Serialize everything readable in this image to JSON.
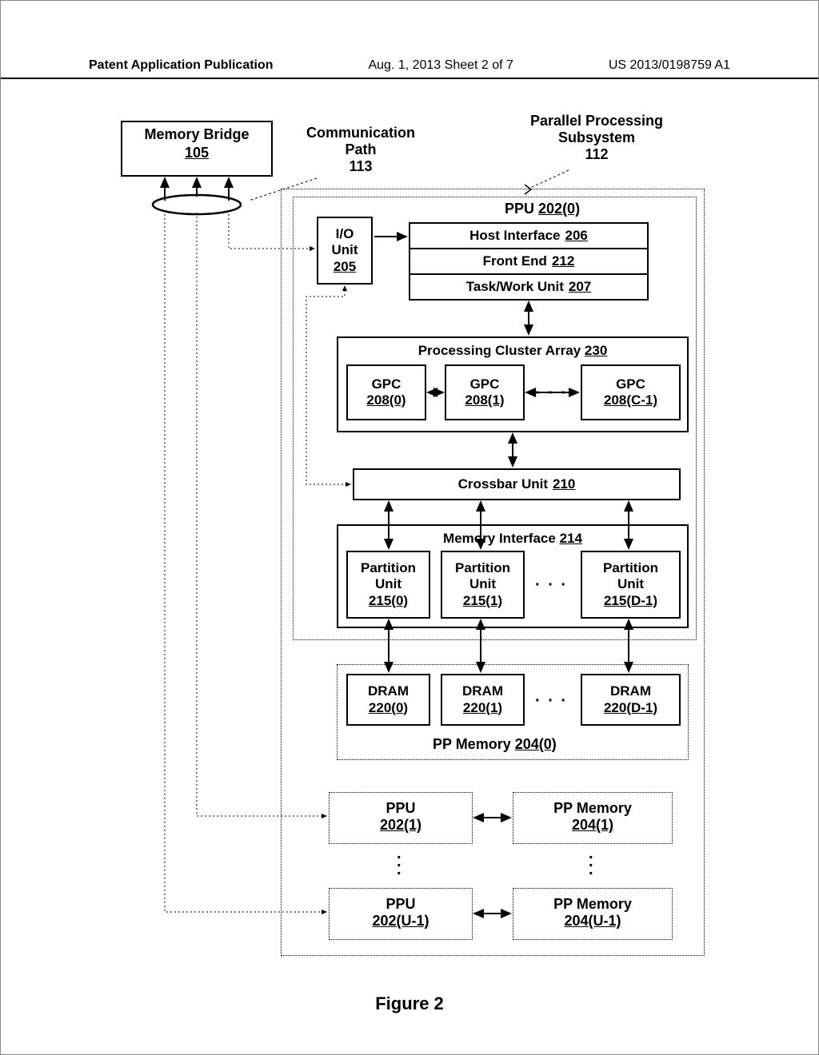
{
  "header": {
    "left": "Patent Application Publication",
    "mid": "Aug. 1, 2013  Sheet 2 of 7",
    "right": "US 2013/0198759 A1"
  },
  "labels": {
    "memory_bridge": "Memory Bridge",
    "memory_bridge_ref": "105",
    "comm_path": "Communication",
    "comm_path2": "Path",
    "comm_path_ref": "113",
    "pps": "Parallel Processing",
    "pps2": "Subsystem",
    "pps_ref": "112",
    "ppu0": "PPU",
    "ppu0_ref": "202(0)",
    "io_unit": "I/O",
    "io_unit2": "Unit",
    "io_unit_ref": "205",
    "host_if": "Host Interface",
    "host_if_ref": "206",
    "front_end": "Front End",
    "front_end_ref": "212",
    "task_work": "Task/Work Unit",
    "task_work_ref": "207",
    "pca": "Processing Cluster Array",
    "pca_ref": "230",
    "gpc": "GPC",
    "gpc0_ref": "208(0)",
    "gpc1_ref": "208(1)",
    "gpcC_ref": "208(C-1)",
    "crossbar": "Crossbar Unit",
    "crossbar_ref": "210",
    "mem_if": "Memory Interface",
    "mem_if_ref": "214",
    "part_unit": "Partition",
    "part_unit2": "Unit",
    "part0_ref": "215(0)",
    "part1_ref": "215(1)",
    "partD_ref": "215(D-1)",
    "dram": "DRAM",
    "dram0_ref": "220(0)",
    "dram1_ref": "220(1)",
    "dramD_ref": "220(D-1)",
    "pp_mem0": "PP Memory",
    "pp_mem0_ref": "204(0)",
    "ppu1": "PPU",
    "ppu1_ref": "202(1)",
    "pp_mem1": "PP Memory",
    "pp_mem1_ref": "204(1)",
    "ppuU": "PPU",
    "ppuU_ref": "202(U-1)",
    "pp_memU": "PP Memory",
    "pp_memU_ref": "204(U-1)",
    "figure": "Figure 2"
  }
}
